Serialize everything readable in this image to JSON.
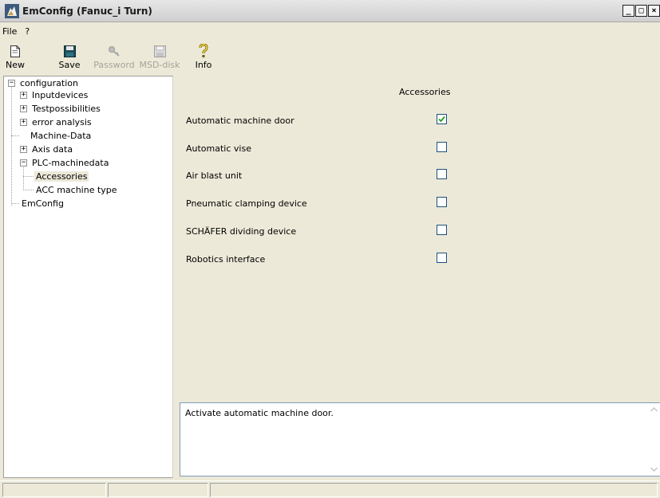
{
  "window": {
    "title": "EmConfig (Fanuc_i Turn)",
    "controls": {
      "minimize": "_",
      "maximize": "□",
      "close": "×"
    }
  },
  "menu": {
    "items": [
      "File",
      "?"
    ]
  },
  "toolbar": {
    "new_label": "New",
    "save_label": "Save",
    "password_label": "Password",
    "msd_label": "MSD-disk",
    "info_label": "Info"
  },
  "tree": {
    "root": "configuration",
    "items": [
      {
        "label": "Inputdevices",
        "expandable": true,
        "expander": "+"
      },
      {
        "label": "Testpossibilities",
        "expandable": true,
        "expander": "+"
      },
      {
        "label": "error analysis",
        "expandable": true,
        "expander": "+"
      },
      {
        "label": "Machine-Data",
        "expandable": false
      },
      {
        "label": "Axis data",
        "expandable": true,
        "expander": "+"
      },
      {
        "label": "PLC-machinedata",
        "expandable": true,
        "expander": "−"
      },
      {
        "label": "Accessories",
        "child": true,
        "selected": true
      },
      {
        "label": "ACC machine type",
        "child": true
      },
      {
        "label": "EmConfig",
        "expandable": false
      }
    ],
    "root_expander": "−"
  },
  "content": {
    "header": "Accessories",
    "options": [
      {
        "label": "Automatic machine door",
        "checked": true
      },
      {
        "label": "Automatic vise",
        "checked": false
      },
      {
        "label": "Air blast unit",
        "checked": false
      },
      {
        "label": "Pneumatic clamping device",
        "checked": false
      },
      {
        "label": "SCHÄFER dividing device",
        "checked": false
      },
      {
        "label": "Robotics interface",
        "checked": false
      }
    ],
    "description": "Activate automatic machine door."
  },
  "colors": {
    "face": "#ece9d8",
    "check_border": "#1c5180",
    "check_mark": "#21a121",
    "selection": "#ece9d8"
  }
}
